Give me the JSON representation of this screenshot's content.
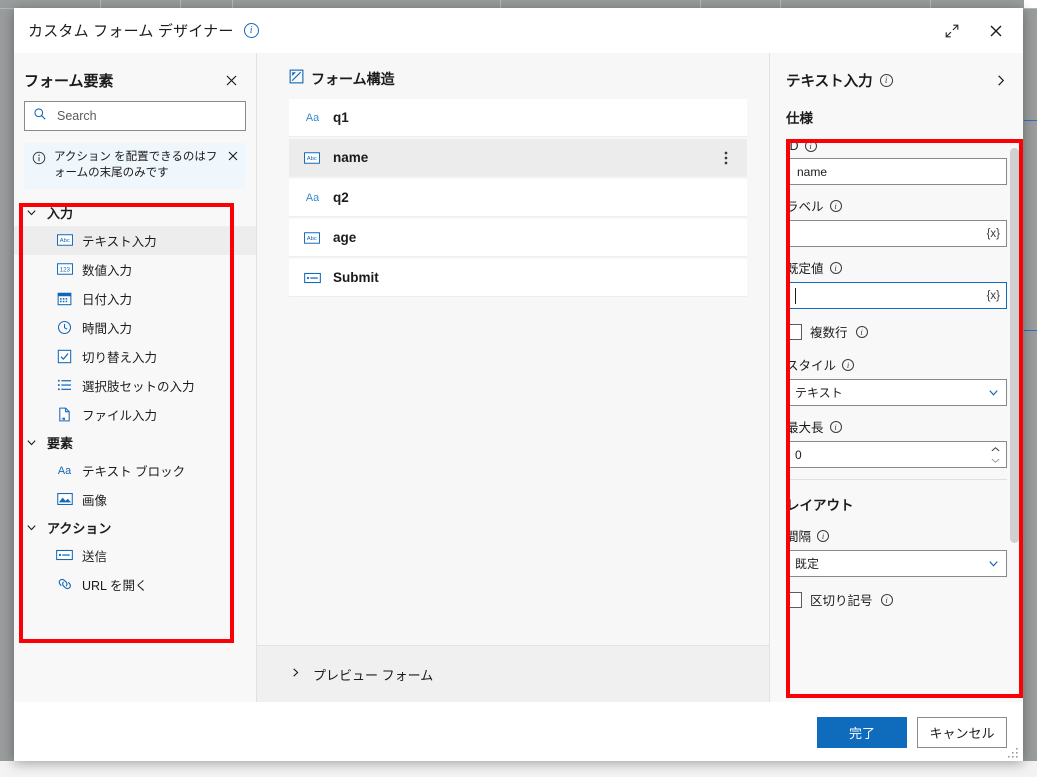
{
  "window": {
    "title": "カスタム フォーム デザイナー",
    "info_icon": "info-icon",
    "expand_icon": "expand-icon",
    "close_icon": "close-icon"
  },
  "left_panel": {
    "title": "フォーム要素",
    "close_icon": "close-icon",
    "search": {
      "placeholder": "Search",
      "value": "",
      "icon": "search-icon"
    },
    "info_banner": {
      "icon": "info-icon",
      "text": "アクション を配置できるのはフォームの末尾のみです",
      "close_icon": "close-icon"
    },
    "groups": [
      {
        "label": "入力",
        "expanded": true,
        "chevron": "chevron-down-icon",
        "items": [
          {
            "label": "テキスト入力",
            "icon": "abc-textbox-icon",
            "selected": true
          },
          {
            "label": "数値入力",
            "icon": "123-number-icon",
            "selected": false
          },
          {
            "label": "日付入力",
            "icon": "calendar-icon",
            "selected": false
          },
          {
            "label": "時間入力",
            "icon": "clock-icon",
            "selected": false
          },
          {
            "label": "切り替え入力",
            "icon": "checkbox-check-icon",
            "selected": false
          },
          {
            "label": "選択肢セットの入力",
            "icon": "list-options-icon",
            "selected": false
          },
          {
            "label": "ファイル入力",
            "icon": "file-upload-icon",
            "selected": false
          }
        ]
      },
      {
        "label": "要素",
        "expanded": true,
        "chevron": "chevron-down-icon",
        "items": [
          {
            "label": "テキスト ブロック",
            "icon": "aa-text-icon",
            "selected": false
          },
          {
            "label": "画像",
            "icon": "image-icon",
            "selected": false
          }
        ]
      },
      {
        "label": "アクション",
        "expanded": true,
        "chevron": "chevron-down-icon",
        "items": [
          {
            "label": "送信",
            "icon": "submit-button-icon",
            "selected": false
          },
          {
            "label": "URL を開く",
            "icon": "link-icon",
            "selected": false
          }
        ]
      }
    ]
  },
  "center_panel": {
    "title": "フォーム構造",
    "title_icon": "form-structure-icon",
    "rows": [
      {
        "label": "q1",
        "icon": "aa-text-icon",
        "selected": false
      },
      {
        "label": "name",
        "icon": "abc-textbox-icon",
        "selected": true,
        "more_icon": "more-vertical-icon"
      },
      {
        "label": "q2",
        "icon": "aa-text-icon",
        "selected": false
      },
      {
        "label": "age",
        "icon": "abc-textbox-icon",
        "selected": false
      },
      {
        "label": "Submit",
        "icon": "submit-button-icon",
        "selected": false
      }
    ],
    "preview": {
      "label": "プレビュー フォーム",
      "chevron": "chevron-right-icon",
      "expanded": false
    }
  },
  "right_panel": {
    "title": "テキスト入力",
    "title_info_icon": "info-icon",
    "collapse_icon": "chevron-right-icon",
    "sections": [
      {
        "name": "仕様",
        "fields": [
          {
            "label": "ID",
            "type": "text",
            "value": "name",
            "placeholder": "",
            "info_icon": "info-icon",
            "focused": false,
            "expression_token": ""
          },
          {
            "label": "ラベル",
            "type": "text",
            "value": "",
            "placeholder": "",
            "info_icon": "info-icon",
            "focused": false,
            "expression_token": "{x}"
          },
          {
            "label": "既定値",
            "type": "text",
            "value": "",
            "placeholder": "",
            "info_icon": "info-icon",
            "focused": true,
            "expression_token": "{x}"
          },
          {
            "label": "複数行",
            "type": "checkbox",
            "checked": false,
            "info_icon": "info-icon"
          },
          {
            "label": "スタイル",
            "type": "select",
            "value": "テキスト",
            "info_icon": "info-icon",
            "chevron": "chevron-down-icon"
          },
          {
            "label": "最大長",
            "type": "spinner",
            "value": "0",
            "info_icon": "info-icon",
            "up_icon": "chevron-up-icon",
            "down_icon": "chevron-down-icon"
          }
        ]
      },
      {
        "name": "レイアウト",
        "fields": [
          {
            "label": "間隔",
            "type": "select",
            "value": "既定",
            "info_icon": "info-icon",
            "chevron": "chevron-down-icon"
          },
          {
            "label": "区切り記号",
            "type": "checkbox",
            "checked": false,
            "info_icon": "info-icon"
          }
        ]
      }
    ],
    "scrollbar": "vertical-scrollbar"
  },
  "footer": {
    "primary_label": "完了",
    "secondary_label": "キャンセル"
  },
  "colors": {
    "accent": "#0f6cbd",
    "annotation": "#fb0007",
    "icon_blue": "#1267b7",
    "info_bg": "#eff6fc"
  }
}
